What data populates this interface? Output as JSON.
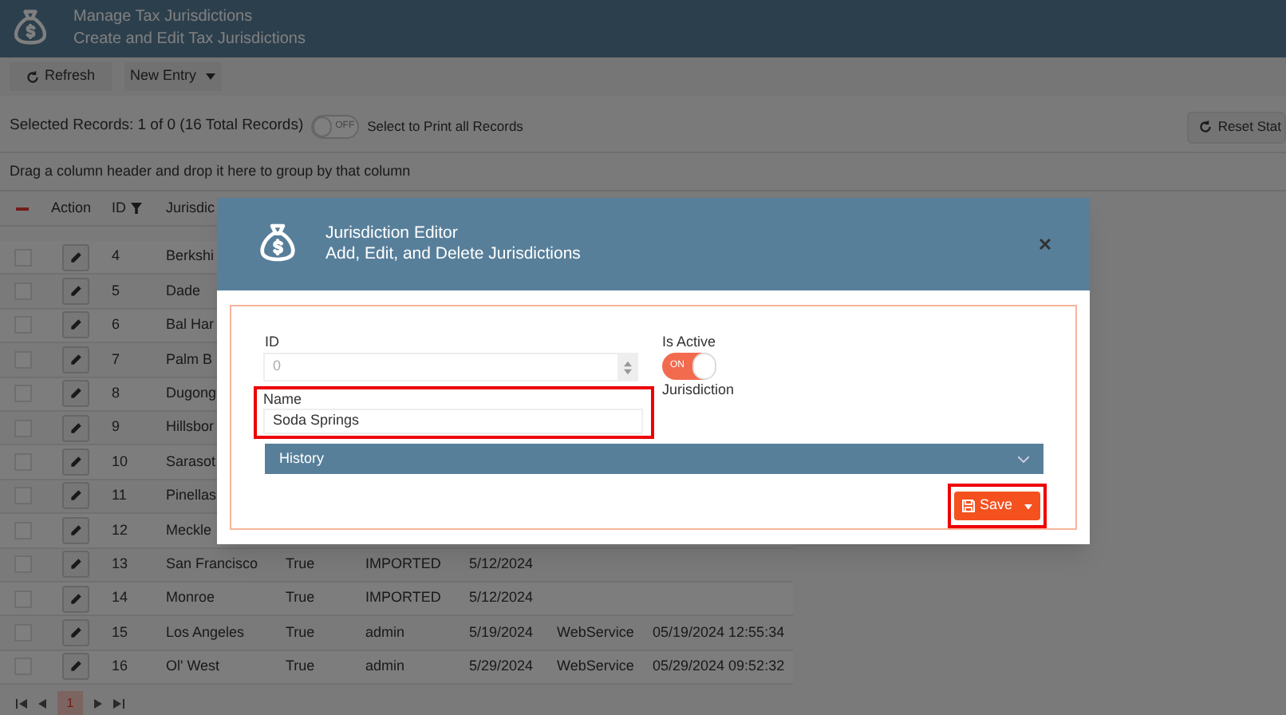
{
  "app_header": {
    "title": "Manage Tax Jurisdictions",
    "subtitle": "Create and Edit Tax Jurisdictions"
  },
  "toolbar": {
    "refresh": "Refresh",
    "new_entry": "New Entry"
  },
  "selection_bar": {
    "text": "Selected Records: 1 of 0 (16 Total Records)",
    "print_all_toggle": {
      "on": false,
      "label": "OFF"
    },
    "print_all_label": "Select to Print all Records",
    "reset_button": "Reset Stat"
  },
  "group_hint": "Drag a column header and drop it here to group by that column",
  "table": {
    "columns": [
      "Action",
      "ID",
      "Jurisdic"
    ],
    "rows": [
      {
        "checked": false,
        "cells": [
          "",
          "4",
          "Berkshi"
        ]
      },
      {
        "checked": false,
        "cells": [
          "",
          "5",
          "Dade"
        ]
      },
      {
        "checked": false,
        "cells": [
          "",
          "6",
          "Bal Har"
        ]
      },
      {
        "checked": false,
        "cells": [
          "",
          "7",
          "Palm B"
        ]
      },
      {
        "checked": false,
        "cells": [
          "",
          "8",
          "Dugong"
        ]
      },
      {
        "checked": false,
        "cells": [
          "",
          "9",
          "Hillsbor"
        ]
      },
      {
        "checked": false,
        "cells": [
          "",
          "10",
          "Sarasot"
        ]
      },
      {
        "checked": false,
        "cells": [
          "",
          "11",
          "Pinellas"
        ]
      },
      {
        "checked": false,
        "cells": [
          "",
          "12",
          "Meckle"
        ]
      },
      {
        "checked": false,
        "cells": [
          "",
          "13",
          "San Francisco",
          "True",
          "IMPORTED",
          "5/12/2024",
          "",
          ""
        ]
      },
      {
        "checked": false,
        "cells": [
          "",
          "14",
          "Monroe",
          "True",
          "IMPORTED",
          "5/12/2024",
          "",
          ""
        ]
      },
      {
        "checked": false,
        "cells": [
          "",
          "15",
          "Los Angeles",
          "True",
          "admin",
          "5/19/2024",
          "WebService",
          "05/19/2024 12:55:34"
        ]
      },
      {
        "checked": false,
        "cells": [
          "",
          "16",
          "Ol' West",
          "True",
          "admin",
          "5/29/2024",
          "WebService",
          "05/29/2024 09:52:32"
        ]
      }
    ]
  },
  "pager": {
    "pages": [
      {
        "label": "1",
        "selected": true
      }
    ]
  },
  "dialog": {
    "title": "Jurisdiction Editor",
    "subtitle": "Add, Edit, and Delete Jurisdictions",
    "id_label": "ID",
    "id_value": "0",
    "name_label": "Name",
    "name_value": "Soda Springs",
    "is_active_label": "Is Active",
    "is_active": {
      "on": true,
      "label": "ON"
    },
    "is_active_caption": "Jurisdiction",
    "history": {
      "label": "History",
      "expanded": false
    },
    "save_button": "Save"
  }
}
